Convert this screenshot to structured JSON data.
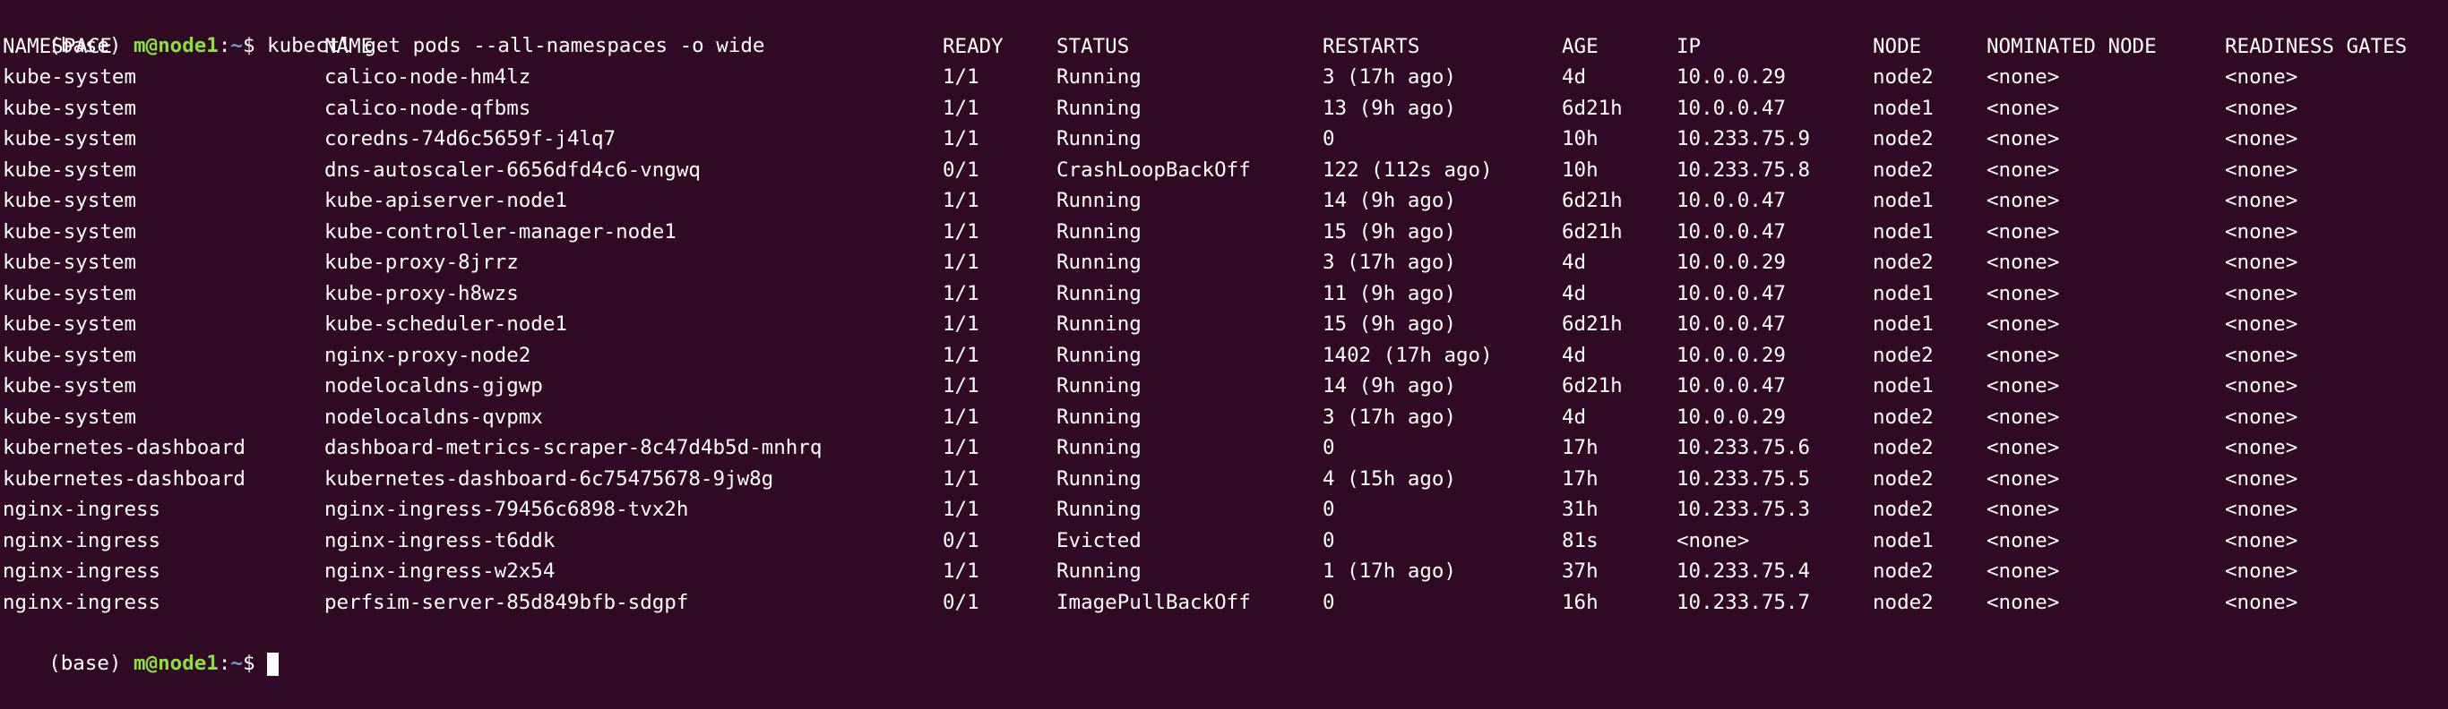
{
  "terminal": {
    "prompt_env": "(base) ",
    "prompt_user": "m@node1",
    "prompt_sep": ":",
    "prompt_path": "~",
    "prompt_symbol": "$ ",
    "command": "kubectl get pods --all-namespaces -o wide",
    "headers": [
      "NAMESPACE",
      "NAME",
      "READY",
      "STATUS",
      "RESTARTS",
      "AGE",
      "IP",
      "NODE",
      "NOMINATED NODE",
      "READINESS GATES"
    ],
    "rows": [
      [
        "kube-system",
        "calico-node-hm4lz",
        "1/1",
        "Running",
        "3 (17h ago)",
        "4d",
        "10.0.0.29",
        "node2",
        "<none>",
        "<none>"
      ],
      [
        "kube-system",
        "calico-node-qfbms",
        "1/1",
        "Running",
        "13 (9h ago)",
        "6d21h",
        "10.0.0.47",
        "node1",
        "<none>",
        "<none>"
      ],
      [
        "kube-system",
        "coredns-74d6c5659f-j4lq7",
        "1/1",
        "Running",
        "0",
        "10h",
        "10.233.75.9",
        "node2",
        "<none>",
        "<none>"
      ],
      [
        "kube-system",
        "dns-autoscaler-6656dfd4c6-vngwq",
        "0/1",
        "CrashLoopBackOff",
        "122 (112s ago)",
        "10h",
        "10.233.75.8",
        "node2",
        "<none>",
        "<none>"
      ],
      [
        "kube-system",
        "kube-apiserver-node1",
        "1/1",
        "Running",
        "14 (9h ago)",
        "6d21h",
        "10.0.0.47",
        "node1",
        "<none>",
        "<none>"
      ],
      [
        "kube-system",
        "kube-controller-manager-node1",
        "1/1",
        "Running",
        "15 (9h ago)",
        "6d21h",
        "10.0.0.47",
        "node1",
        "<none>",
        "<none>"
      ],
      [
        "kube-system",
        "kube-proxy-8jrrz",
        "1/1",
        "Running",
        "3 (17h ago)",
        "4d",
        "10.0.0.29",
        "node2",
        "<none>",
        "<none>"
      ],
      [
        "kube-system",
        "kube-proxy-h8wzs",
        "1/1",
        "Running",
        "11 (9h ago)",
        "4d",
        "10.0.0.47",
        "node1",
        "<none>",
        "<none>"
      ],
      [
        "kube-system",
        "kube-scheduler-node1",
        "1/1",
        "Running",
        "15 (9h ago)",
        "6d21h",
        "10.0.0.47",
        "node1",
        "<none>",
        "<none>"
      ],
      [
        "kube-system",
        "nginx-proxy-node2",
        "1/1",
        "Running",
        "1402 (17h ago)",
        "4d",
        "10.0.0.29",
        "node2",
        "<none>",
        "<none>"
      ],
      [
        "kube-system",
        "nodelocaldns-gjgwp",
        "1/1",
        "Running",
        "14 (9h ago)",
        "6d21h",
        "10.0.0.47",
        "node1",
        "<none>",
        "<none>"
      ],
      [
        "kube-system",
        "nodelocaldns-qvpmx",
        "1/1",
        "Running",
        "3 (17h ago)",
        "4d",
        "10.0.0.29",
        "node2",
        "<none>",
        "<none>"
      ],
      [
        "kubernetes-dashboard",
        "dashboard-metrics-scraper-8c47d4b5d-mnhrq",
        "1/1",
        "Running",
        "0",
        "17h",
        "10.233.75.6",
        "node2",
        "<none>",
        "<none>"
      ],
      [
        "kubernetes-dashboard",
        "kubernetes-dashboard-6c75475678-9jw8g",
        "1/1",
        "Running",
        "4 (15h ago)",
        "17h",
        "10.233.75.5",
        "node2",
        "<none>",
        "<none>"
      ],
      [
        "nginx-ingress",
        "nginx-ingress-79456c6898-tvx2h",
        "1/1",
        "Running",
        "0",
        "31h",
        "10.233.75.3",
        "node2",
        "<none>",
        "<none>"
      ],
      [
        "nginx-ingress",
        "nginx-ingress-t6ddk",
        "0/1",
        "Evicted",
        "0",
        "81s",
        "<none>",
        "node1",
        "<none>",
        "<none>"
      ],
      [
        "nginx-ingress",
        "nginx-ingress-w2x54",
        "1/1",
        "Running",
        "1 (17h ago)",
        "37h",
        "10.233.75.4",
        "node2",
        "<none>",
        "<none>"
      ],
      [
        "nginx-ingress",
        "perfsim-server-85d849bfb-sdgpf",
        "0/1",
        "ImagePullBackOff",
        "0",
        "16h",
        "10.233.75.7",
        "node2",
        "<none>",
        "<none>"
      ]
    ],
    "colors": {
      "background": "#300a24",
      "text": "#ffffff",
      "prompt_user": "#8ae234",
      "prompt_path": "#729fcf"
    }
  }
}
